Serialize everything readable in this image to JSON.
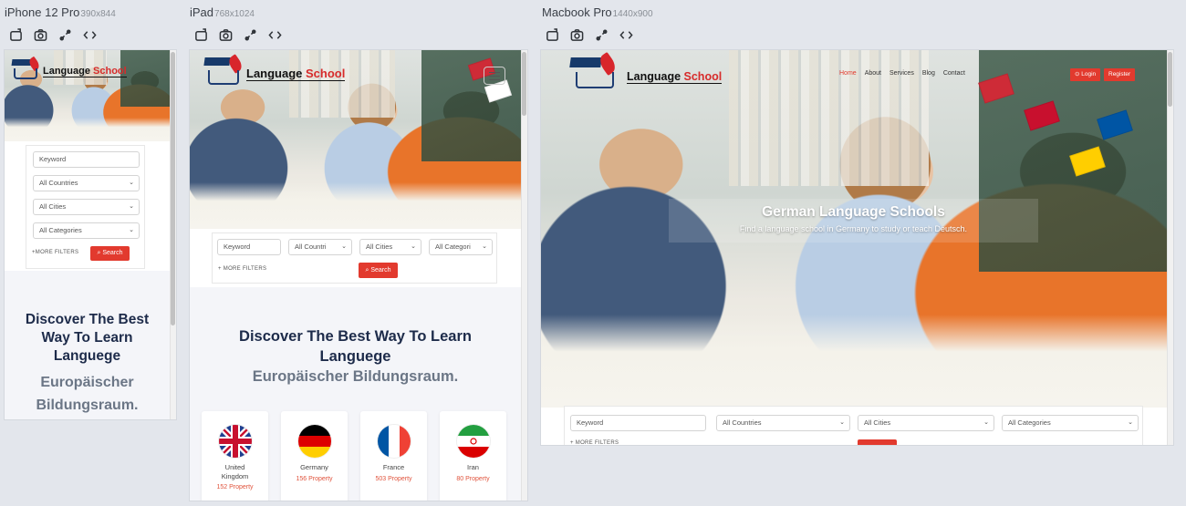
{
  "devices": [
    {
      "name": "iPhone 12 Pro",
      "dims": "390x844"
    },
    {
      "name": "iPad",
      "dims": "768x1024"
    },
    {
      "name": "Macbook Pro",
      "dims": "1440x900"
    }
  ],
  "toolbar_icons": [
    "rotate-icon",
    "screenshot-icon",
    "sync-icon",
    "code-icon"
  ],
  "site": {
    "logo_prefix": "Language ",
    "logo_school": "School",
    "nav": [
      "Home",
      "About",
      "Services",
      "Blog",
      "Contact"
    ],
    "login": "⊙ Login",
    "register": "Register",
    "hero_title": "German Language Schools",
    "hero_subtitle": "Find a language school in Germany to study or teach Deutsch."
  },
  "search": {
    "keyword_placeholder": "Keyword",
    "all_countries": "All Countries",
    "all_cities": "All Cities",
    "all_categories": "All Categories",
    "ipad_countries": "All Countri",
    "ipad_categories": "All Categori",
    "more_filters_phone": "+MORE FILTERS",
    "more_filters": "+ MORE FILTERS",
    "search_button": "⌕ Search"
  },
  "discover": {
    "phone_title": "Discover The Best Way To Learn Languege",
    "ipad_title": "Discover The Best Way To Learn Languege",
    "subtitle": "Europäischer Bildungsraum."
  },
  "countries": [
    {
      "name": "United Kingdom",
      "property": "152 Property"
    },
    {
      "name": "Germany",
      "property": "156 Property"
    },
    {
      "name": "France",
      "property": "503 Property"
    },
    {
      "name": "Iran",
      "property": "80 Property"
    }
  ],
  "colors": {
    "accent": "#e23a2e",
    "brand_navy": "#173a6a",
    "background": "#e3e6ec"
  }
}
